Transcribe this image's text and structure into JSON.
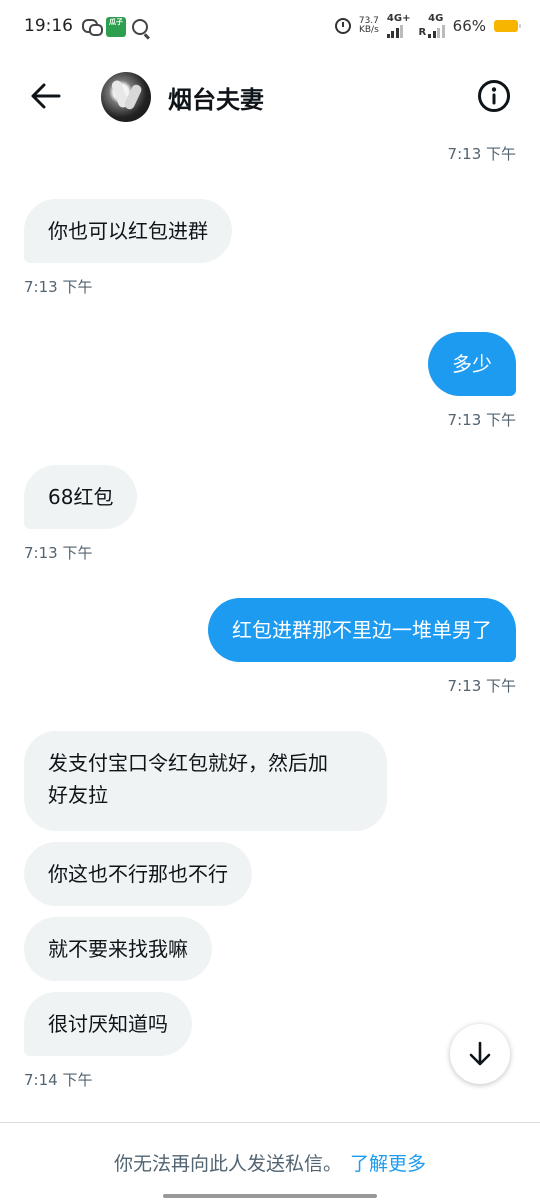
{
  "status_bar": {
    "time": "19:16",
    "guazi_label": "瓜子",
    "net_speed_value": "73.7",
    "net_speed_unit": "KB/s",
    "network_1": "4G+",
    "network_2": "4G",
    "roaming": "R",
    "battery_percent": "66%",
    "battery_level": 0.66
  },
  "header": {
    "contact_name": "烟台夫妻"
  },
  "messages": [
    {
      "direction": "out",
      "text": "",
      "time": "7:13 下午"
    },
    {
      "direction": "in",
      "text": "你也可以红包进群",
      "time": "7:13 下午"
    },
    {
      "direction": "out",
      "text": "多少",
      "time": "7:13 下午"
    },
    {
      "direction": "in",
      "text": "68红包",
      "time": "7:13 下午"
    },
    {
      "direction": "out",
      "text": "红包进群那不里边一堆单男了",
      "time": "7:13 下午"
    },
    {
      "direction": "in",
      "text_line1": "发支付宝口令红包就好，然后加",
      "text_line2": "好友拉"
    },
    {
      "direction": "in",
      "text": "你这也不行那也不行"
    },
    {
      "direction": "in",
      "text": "就不要来找我嘛"
    },
    {
      "direction": "in",
      "text": "很讨厌知道吗",
      "time": "7:14 下午"
    }
  ],
  "footer": {
    "notice": "你无法再向此人发送私信。",
    "link": "了解更多"
  },
  "colors": {
    "accent": "#1d9bf0",
    "incoming_bubble": "#eff3f4",
    "timestamp": "#536471"
  },
  "icons": {
    "back": "arrow-left-icon",
    "info": "info-circle-icon",
    "scroll_down": "arrow-down-icon"
  }
}
